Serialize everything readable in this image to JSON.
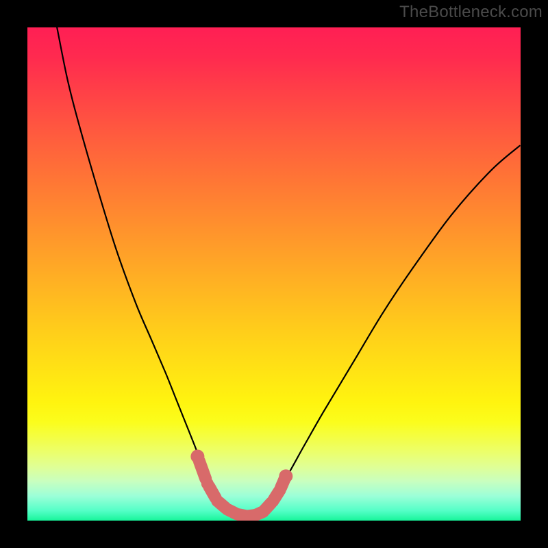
{
  "watermark": "TheBottleneck.com",
  "colors": {
    "frame_bg": "#000000",
    "curve_stroke": "#000000",
    "marker_fill": "#d86a6a",
    "gradient_top": "#ff1f54",
    "gradient_bottom": "#18f59a"
  },
  "chart_data": {
    "type": "line",
    "title": "",
    "xlabel": "",
    "ylabel": "",
    "xlim": [
      0,
      100
    ],
    "ylim": [
      0,
      100
    ],
    "series": [
      {
        "name": "bottleneck-curve",
        "x": [
          6,
          8,
          10,
          14,
          18,
          22,
          25,
          28,
          30,
          32,
          34,
          35.5,
          37,
          38.5,
          40,
          42,
          44,
          46,
          48,
          52,
          56,
          60,
          66,
          72,
          78,
          86,
          94,
          99.8
        ],
        "y": [
          100,
          90,
          82,
          68,
          55,
          44,
          37,
          30,
          25,
          20,
          15,
          11,
          8,
          5,
          3,
          1.5,
          0.8,
          1.2,
          3,
          8,
          15,
          22,
          32,
          42,
          51,
          62,
          71,
          76
        ]
      }
    ],
    "markers": {
      "name": "highlighted-points",
      "x": [
        34.5,
        36.5,
        38.5,
        40.5,
        42.5,
        44.5,
        46.2,
        47.8,
        49.8,
        51.2,
        52.4
      ],
      "y": [
        13,
        7.5,
        4,
        2.3,
        1.3,
        0.9,
        1.1,
        1.8,
        4,
        6.2,
        9
      ]
    }
  }
}
